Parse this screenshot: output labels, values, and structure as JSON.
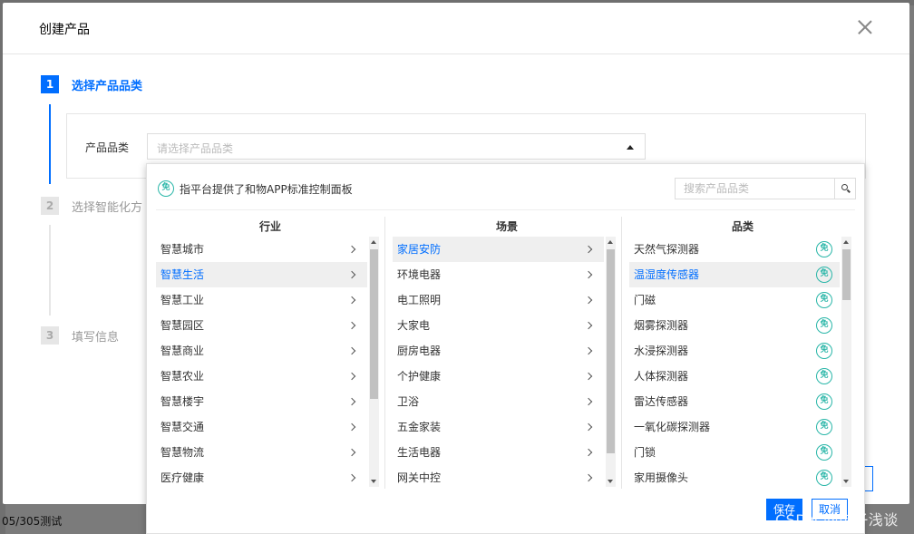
{
  "background": {
    "bottom_text": "05/305测试"
  },
  "modal": {
    "title": "创建产品",
    "steps": [
      {
        "num": "1",
        "label": "选择产品品类",
        "state": "active"
      },
      {
        "num": "2",
        "label": "选择智能化方",
        "state": "idle"
      },
      {
        "num": "3",
        "label": "填写信息",
        "state": "idle"
      }
    ],
    "form": {
      "label": "产品品类",
      "placeholder": "请选择产品品类"
    }
  },
  "dropdown": {
    "notice_icon": "免",
    "notice": "指平台提供了和物APP标准控制面板",
    "search_placeholder": "搜索产品品类",
    "columns": {
      "industry": {
        "header": "行业",
        "items": [
          "智慧城市",
          "智慧生活",
          "智慧工业",
          "智慧园区",
          "智慧商业",
          "智慧农业",
          "智慧楼宇",
          "智慧交通",
          "智慧物流",
          "医疗健康"
        ],
        "selected_index": 1
      },
      "scene": {
        "header": "场景",
        "items": [
          "家居安防",
          "环境电器",
          "电工照明",
          "大家电",
          "厨房电器",
          "个护健康",
          "卫浴",
          "五金家装",
          "生活电器",
          "网关中控"
        ],
        "selected_index": 0
      },
      "category": {
        "header": "品类",
        "items": [
          "天然气探测器",
          "温湿度传感器",
          "门磁",
          "烟雾探测器",
          "水浸探测器",
          "人体探测器",
          "雷达传感器",
          "一氧化碳探测器",
          "门锁",
          "家用摄像头"
        ],
        "selected_index": 1
      }
    },
    "save_label": "保存",
    "cancel_label": "取消"
  },
  "watermark": "CSDN @电子浅谈",
  "colors": {
    "accent": "#006eff",
    "badge": "#29b6a8"
  }
}
